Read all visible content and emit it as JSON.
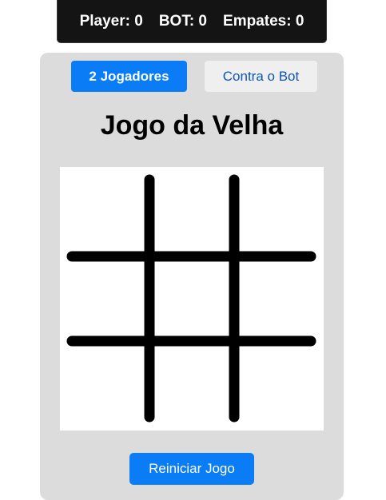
{
  "score": {
    "player": "Player: 0",
    "bot": "BOT: 0",
    "ties": "Empates: 0"
  },
  "modes": {
    "two_players": "2 Jogadores",
    "vs_bot": "Contra o Bot",
    "active": "two_players"
  },
  "title": "Jogo da Velha",
  "board": {
    "cells": [
      "",
      "",
      "",
      "",
      "",
      "",
      "",
      "",
      ""
    ]
  },
  "reset_label": "Reiniciar Jogo",
  "colors": {
    "accent": "#0a7cf5",
    "scorebar_bg": "#141414",
    "panel_bg": "#dcdcdc",
    "grid_line": "#000000"
  }
}
